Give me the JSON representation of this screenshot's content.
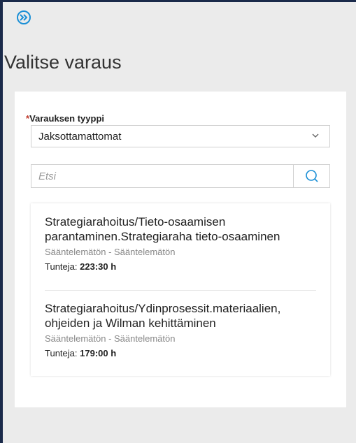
{
  "page": {
    "title": "Valitse varaus"
  },
  "form": {
    "type_label_required": "*",
    "type_label": "Varauksen tyyppi",
    "type_selected": "Jaksottamattomat",
    "search_placeholder": "Etsi"
  },
  "results": [
    {
      "title": "Strategiarahoitus/Tieto-osaamisen parantaminen.Strategiaraha tieto-osaaminen",
      "subtitle": "Sääntelemätön - Sääntelemätön",
      "hours_label": "Tunteja:",
      "hours_value": "223:30 h"
    },
    {
      "title": "Strategiarahoitus/Ydinprosessit.materiaalien, ohjeiden ja Wilman kehittäminen",
      "subtitle": "Sääntelemätön - Sääntelemätön",
      "hours_label": "Tunteja:",
      "hours_value": "179:00 h"
    }
  ],
  "icons": {
    "expand": "double-chevron-right-icon",
    "dropdown": "chevron-down-icon",
    "search": "search-icon"
  },
  "colors": {
    "accent": "#1a8fd6",
    "required": "#c0392b"
  }
}
